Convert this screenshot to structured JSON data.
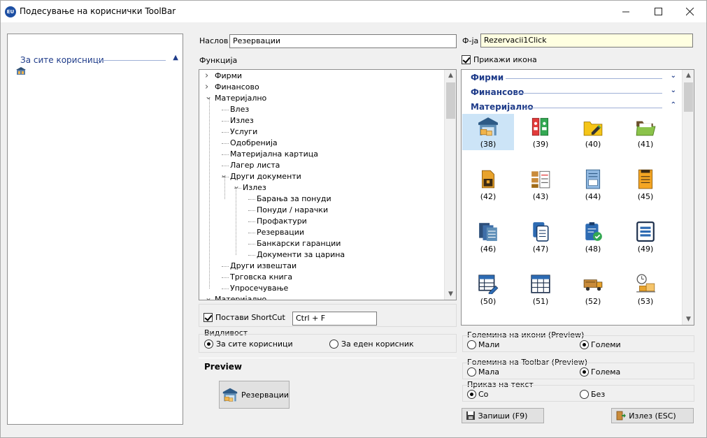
{
  "window": {
    "title": "Подесување на кориснички ToolBar",
    "app_icon_text": "EU",
    "minimize": "—",
    "maximize": "☐",
    "close": "✕"
  },
  "left_panel": {
    "group_label": "За сите корисници"
  },
  "form": {
    "title_label": "Наслов",
    "title_value": "Резервации",
    "func_code_label": "Ф-ја",
    "func_code_value": "Rezervacii1Click",
    "function_label": "Функција",
    "show_icon_label": "Прикажи икона",
    "show_icon_checked": true
  },
  "tree": [
    {
      "label": "Фирми",
      "level": 0,
      "arrow": "right"
    },
    {
      "label": "Финансово",
      "level": 0,
      "arrow": "right"
    },
    {
      "label": "Материјално",
      "level": 0,
      "arrow": "down"
    },
    {
      "label": "Влез",
      "level": 1,
      "arrow": ""
    },
    {
      "label": "Излез",
      "level": 1,
      "arrow": ""
    },
    {
      "label": "Услуги",
      "level": 1,
      "arrow": ""
    },
    {
      "label": "Одобренија",
      "level": 1,
      "arrow": ""
    },
    {
      "label": "Материјална картица",
      "level": 1,
      "arrow": ""
    },
    {
      "label": "Лагер листа",
      "level": 1,
      "arrow": ""
    },
    {
      "label": "Други документи",
      "level": 1,
      "arrow": "down"
    },
    {
      "label": "Излез",
      "level": 2,
      "arrow": "down"
    },
    {
      "label": "Барања за понуди",
      "level": 3,
      "arrow": ""
    },
    {
      "label": "Понуди / нарачки",
      "level": 3,
      "arrow": ""
    },
    {
      "label": "Профактури",
      "level": 3,
      "arrow": ""
    },
    {
      "label": "Резервации",
      "level": 3,
      "arrow": ""
    },
    {
      "label": "Банкарски гаранции",
      "level": 3,
      "arrow": ""
    },
    {
      "label": "Документи за царина",
      "level": 3,
      "arrow": ""
    },
    {
      "label": "Други извештаи",
      "level": 1,
      "arrow": ""
    },
    {
      "label": "Трговска книга",
      "level": 1,
      "arrow": ""
    },
    {
      "label": "Упросечување",
      "level": 1,
      "arrow": ""
    },
    {
      "label": "Материјално",
      "level": 0,
      "arrow": "down"
    }
  ],
  "icon_categories": [
    {
      "name": "Фирми",
      "chevron": "down"
    },
    {
      "name": "Финансово",
      "chevron": "down"
    },
    {
      "name": "Материјално",
      "chevron": "up"
    }
  ],
  "icons": [
    {
      "num": "(38)",
      "icon": "warehouse-icon",
      "selected": true
    },
    {
      "num": "(39)",
      "icon": "binders-icon",
      "selected": false
    },
    {
      "num": "(40)",
      "icon": "folder-edit-icon",
      "selected": false
    },
    {
      "num": "(41)",
      "icon": "folder-open-icon",
      "selected": false
    },
    {
      "num": "(42)",
      "icon": "document-box-icon",
      "selected": false
    },
    {
      "num": "(43)",
      "icon": "clipboard-boxes-icon",
      "selected": false
    },
    {
      "num": "(44)",
      "icon": "invoice-icon",
      "selected": false
    },
    {
      "num": "(45)",
      "icon": "orange-document-icon",
      "selected": false
    },
    {
      "num": "(46)",
      "icon": "documents-stack-icon",
      "selected": false
    },
    {
      "num": "(47)",
      "icon": "copy-document-icon",
      "selected": false
    },
    {
      "num": "(48)",
      "icon": "clipboard-check-icon",
      "selected": false
    },
    {
      "num": "(49)",
      "icon": "list-form-icon",
      "selected": false
    },
    {
      "num": "(50)",
      "icon": "table-edit-icon",
      "selected": false
    },
    {
      "num": "(51)",
      "icon": "table-icon",
      "selected": false
    },
    {
      "num": "(52)",
      "icon": "truck-icon",
      "selected": false
    },
    {
      "num": "(53)",
      "icon": "delivery-time-icon",
      "selected": false
    }
  ],
  "shortcut": {
    "label": "Постави ShortCut",
    "checked": true,
    "value": "Ctrl + F"
  },
  "visibility": {
    "label": "Видливост",
    "opt_all": "За сите корисници",
    "opt_one": "За еден корисник",
    "selected": "all"
  },
  "preview": {
    "label": "Preview",
    "button_text": "Резервации"
  },
  "icon_size": {
    "label": "Големина на икони (Preview)",
    "small": "Мали",
    "large": "Големи",
    "selected": "large"
  },
  "toolbar_size": {
    "label": "Големина на Toolbar (Preview)",
    "small": "Мала",
    "large": "Голема",
    "selected": "large"
  },
  "text_display": {
    "label": "Приказ на текст",
    "with": "Со",
    "without": "Без",
    "selected": "with"
  },
  "buttons": {
    "save": "Запиши (F9)",
    "exit": "Излез (ESC)"
  }
}
